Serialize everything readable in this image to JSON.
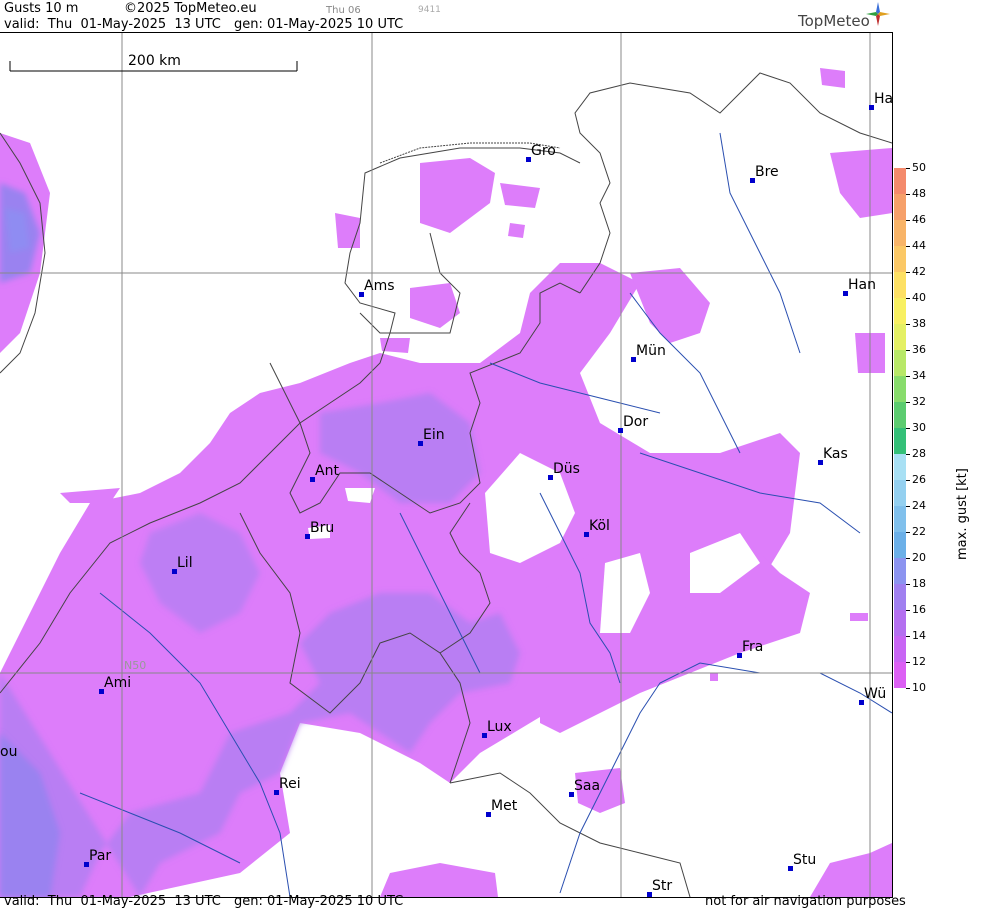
{
  "header": {
    "title": "Gusts 10 m",
    "copyright": "©2025 TopMeteo.eu",
    "day": "Thu 06",
    "code": "9411",
    "valid": "valid:  Thu  01-May-2025  13 UTC",
    "gen": "gen: 01-May-2025 10 UTC",
    "brand": "TopMeteo"
  },
  "footer": {
    "valid": "valid:  Thu  01-May-2025  13 UTC",
    "gen": "gen: 01-May-2025 10 UTC",
    "disclaimer": "not for air navigation purposes"
  },
  "map": {
    "scale_label": "200 km",
    "grid_label": "N50",
    "cities": [
      "Ha",
      "Gro",
      "Bre",
      "Ams",
      "Han",
      "Mün",
      "Ein",
      "Dor",
      "Kas",
      "Ant",
      "Düs",
      "Bru",
      "Köl",
      "Lil",
      "Fra",
      "Ami",
      "Wü",
      "Lux",
      "Rei",
      "Saa",
      "Met",
      "ou",
      "Par",
      "Stu",
      "Str"
    ]
  },
  "legend": {
    "unit_label": "max. gust [kt]",
    "levels": [
      "50",
      "48",
      "46",
      "44",
      "42",
      "40",
      "38",
      "36",
      "34",
      "32",
      "30",
      "28",
      "26",
      "24",
      "22",
      "20",
      "18",
      "16",
      "14",
      "12",
      "10"
    ],
    "colors": [
      "#f48a6c",
      "#f6a06a",
      "#f8b468",
      "#fbc866",
      "#fde064",
      "#f8f062",
      "#e4f064",
      "#b8e868",
      "#88dc6c",
      "#5ccc70",
      "#34c078",
      "#a8e0f4",
      "#94d0f0",
      "#80c0ec",
      "#6cb0e8",
      "#8c94f0",
      "#a080f0",
      "#b470f0",
      "#c866f4",
      "#dc60f4"
    ],
    "accent_low": "#dd7dfa",
    "accent_mid": "#b57ef2",
    "accent_high": "#9a82f0"
  }
}
